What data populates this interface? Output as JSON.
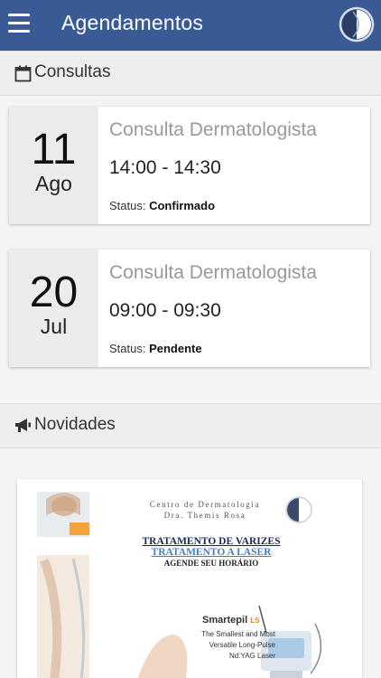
{
  "appbar": {
    "title": "Agendamentos",
    "menu_icon": "hamburger-menu-icon",
    "brand_icon": "clinic-logo-icon"
  },
  "consultas": {
    "title": "Consultas",
    "icon": "calendar-icon",
    "items": [
      {
        "day": "11",
        "month": "Ago",
        "title": "Consulta Dermatologista",
        "time": "14:00 - 14:30",
        "status_label": "Status:",
        "status": "Confirmado"
      },
      {
        "day": "20",
        "month": "Jul",
        "title": "Consulta Dermatologista",
        "time": "09:00 - 09:30",
        "status_label": "Status:",
        "status": "Pendente"
      }
    ]
  },
  "novidades": {
    "title": "Novidades",
    "icon": "megaphone-icon",
    "banner": {
      "clinic_line1": "Centro de Dermatologia",
      "clinic_line2": "Dra. Themis Rosa",
      "headline1": "TRATAMENTO DE VARIZES",
      "headline2": "TRATAMENTO A LASER",
      "headline3": "AGENDE SEU HORÁRIO",
      "product_name": "Smartepil",
      "product_suffix": "LS",
      "product_desc1": "The Smallest and Most",
      "product_desc2": "Versatile Long-Pulse",
      "product_desc3": "Nd:YAG Laser"
    }
  },
  "colors": {
    "appbar": "#3a5a95",
    "date_panel": "#ececec",
    "headline_dark": "#1b2a55",
    "headline_blue": "#4a7ac8"
  }
}
